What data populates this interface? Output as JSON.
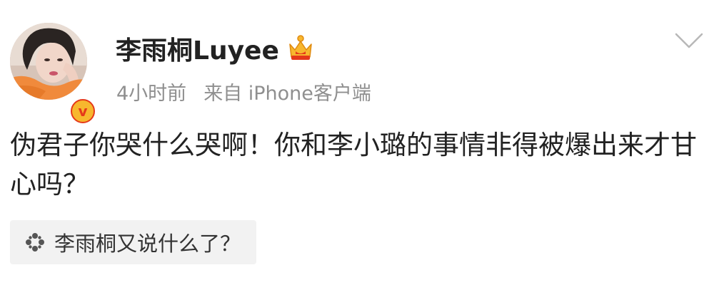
{
  "post": {
    "username": "李雨桐Luyee",
    "time": "4小时前",
    "source": "来自 iPhone客户端",
    "content": "伪君子你哭什么哭啊！你和李小璐的事情非得被爆出来才甘心吗？",
    "topic": "李雨桐又说什么了？"
  },
  "icons": {
    "verified": "verified-v-badge-icon",
    "crown": "crown-icon",
    "menu": "chevron-down-icon",
    "topic": "spark-icon"
  },
  "colors": {
    "text": "#222222",
    "meta": "#8f8f8f",
    "chip_bg": "#f2f2f2",
    "badge_red": "#e5391a",
    "badge_gold": "#f7b72e"
  }
}
